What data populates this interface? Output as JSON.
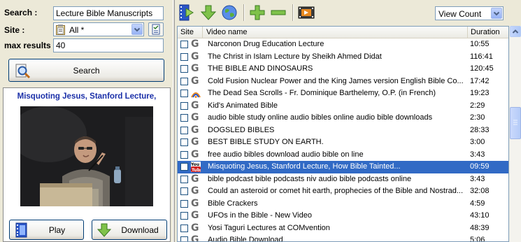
{
  "search": {
    "search_label": "Search :",
    "query": "Lecture Bible Manuscripts",
    "site_label": "Site :",
    "site_value": "All *",
    "max_label": "max results",
    "max_value": "40",
    "search_button": "Search"
  },
  "preview": {
    "title": "Misquoting Jesus, Stanford Lecture,",
    "play_button": "Play",
    "download_button": "Download"
  },
  "toolbar": {
    "view_select": "View Count",
    "icons": [
      "video-list-icon",
      "download-arrow-icon",
      "globe-icon",
      "add-icon",
      "remove-icon",
      "video-clip-icon"
    ]
  },
  "grid": {
    "columns": [
      "Site",
      "Video name",
      "Duration"
    ],
    "rows": [
      {
        "src": "G",
        "name": "Narconon Drug Education Lecture",
        "dur": "10:55"
      },
      {
        "src": "G",
        "name": "The Christ in Islam Lecture by  Sheikh Ahmed Didat",
        "dur": "116:41"
      },
      {
        "src": "G",
        "name": "THE BIBLE AND DINOSAURS",
        "dur": "120:45"
      },
      {
        "src": "G",
        "name": "Cold Fusion Nuclear Power and the King James version English Bible Co...",
        "dur": "17:42"
      },
      {
        "src": "dm",
        "name": "The Dead Sea Scrolls - Fr. Dominique Barthelemy, O.P. (in French)",
        "dur": "19:23"
      },
      {
        "src": "G",
        "name": "Kid's Animated Bible",
        "dur": "2:29"
      },
      {
        "src": "G",
        "name": "audio bible study online audio bibles online audio bible downloads",
        "dur": "2:30"
      },
      {
        "src": "G",
        "name": "DOGSLED BIBLES",
        "dur": "28:33"
      },
      {
        "src": "G",
        "name": "BEST BIBLE STUDY ON EARTH.",
        "dur": "3:00"
      },
      {
        "src": "G",
        "name": "free audio bibles download audio bible on line",
        "dur": "3:43"
      },
      {
        "src": "yt",
        "name": "Misquoting Jesus, Stanford Lecture, How Bible Tainted...",
        "dur": "09:59",
        "selected": true
      },
      {
        "src": "G",
        "name": "bible podcast bible podcasts niv audio bible podcasts online",
        "dur": "3:43"
      },
      {
        "src": "G",
        "name": "Could an asteroid or comet hit earth, prophecies of the Bible and Nostrad...",
        "dur": "32:08"
      },
      {
        "src": "G",
        "name": "Bible Crackers",
        "dur": "4:59"
      },
      {
        "src": "G",
        "name": "UFOs in the Bible - New Video",
        "dur": "43:10"
      },
      {
        "src": "G",
        "name": "Yosi Taguri Lectures at COMvention",
        "dur": "48:39"
      },
      {
        "src": "G",
        "name": "Audio Bible Download",
        "dur": "5:06"
      }
    ]
  },
  "colors": {
    "selection": "#316ac5",
    "title_blue": "#1a2fa8",
    "panel_bg": "#ece9d8"
  }
}
